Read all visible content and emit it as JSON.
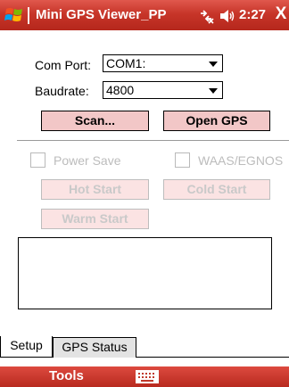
{
  "window": {
    "title": "Mini GPS Viewer_PP",
    "clock": "2:27",
    "close_label": "X",
    "start_icon": "windows-flag-icon",
    "connectivity_icon": "connectivity-icon",
    "volume_icon": "speaker-icon"
  },
  "form": {
    "com_port_label": "Com Port:",
    "com_port_value": "COM1:",
    "baudrate_label": "Baudrate:",
    "baudrate_value": "4800",
    "scan_button": "Scan...",
    "open_gps_button": "Open GPS",
    "power_save_label": "Power Save",
    "waas_label": "WAAS/EGNOS",
    "hot_start_button": "Hot Start",
    "cold_start_button": "Cold Start",
    "warm_start_button": "Warm Start"
  },
  "tabs": [
    {
      "label": "Setup",
      "active": true
    },
    {
      "label": "GPS Status",
      "active": false
    }
  ],
  "menubar": {
    "tools_label": "Tools",
    "keyboard_icon": "keyboard-icon"
  },
  "colors": {
    "titlebar": "#c73529",
    "button_fill": "#f2c7c7",
    "disabled_text": "#c9c9c9"
  }
}
